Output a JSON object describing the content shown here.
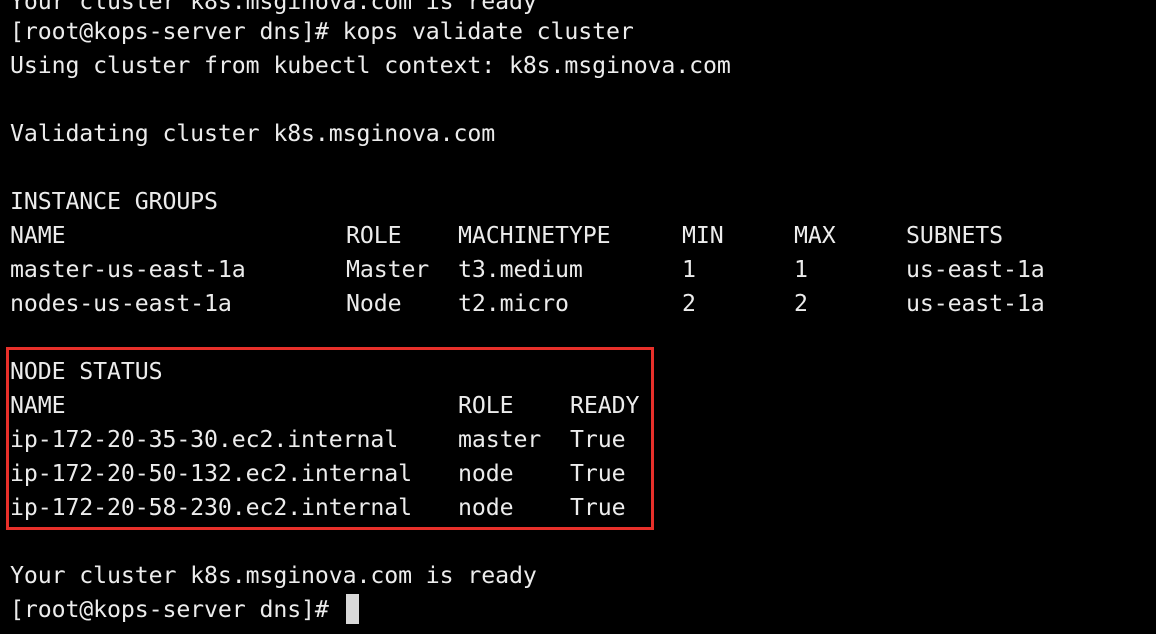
{
  "terminal": {
    "lines": {
      "top_partial": "Your cluster k8s.msginova.com is ready",
      "command": "[root@kops-server dns]# kops validate cluster",
      "context": "Using cluster from kubectl context: k8s.msginova.com",
      "validating": "Validating cluster k8s.msginova.com",
      "ready": "Your cluster k8s.msginova.com is ready",
      "prompt": "[root@kops-server dns]# "
    },
    "instance_groups": {
      "heading": "INSTANCE GROUPS",
      "headers": {
        "name": "NAME",
        "role": "ROLE",
        "machinetype": "MACHINETYPE",
        "min": "MIN",
        "max": "MAX",
        "subnets": "SUBNETS"
      },
      "rows": [
        {
          "name": "master-us-east-1a",
          "role": "Master",
          "machinetype": "t3.medium",
          "min": "1",
          "max": "1",
          "subnets": "us-east-1a"
        },
        {
          "name": "nodes-us-east-1a",
          "role": "Node",
          "machinetype": "t2.micro",
          "min": "2",
          "max": "2",
          "subnets": "us-east-1a"
        }
      ]
    },
    "node_status": {
      "heading": "NODE STATUS",
      "headers": {
        "name": "NAME",
        "role": "ROLE",
        "ready": "READY"
      },
      "rows": [
        {
          "name": "ip-172-20-35-30.ec2.internal",
          "role": "master",
          "ready": "True"
        },
        {
          "name": "ip-172-20-50-132.ec2.internal",
          "role": "node",
          "ready": "True"
        },
        {
          "name": "ip-172-20-58-230.ec2.internal",
          "role": "node",
          "ready": "True"
        }
      ]
    }
  },
  "colors": {
    "background": "#000000",
    "text": "#ececec",
    "highlight": "#e8302a",
    "cursor": "#d9d9d9"
  }
}
